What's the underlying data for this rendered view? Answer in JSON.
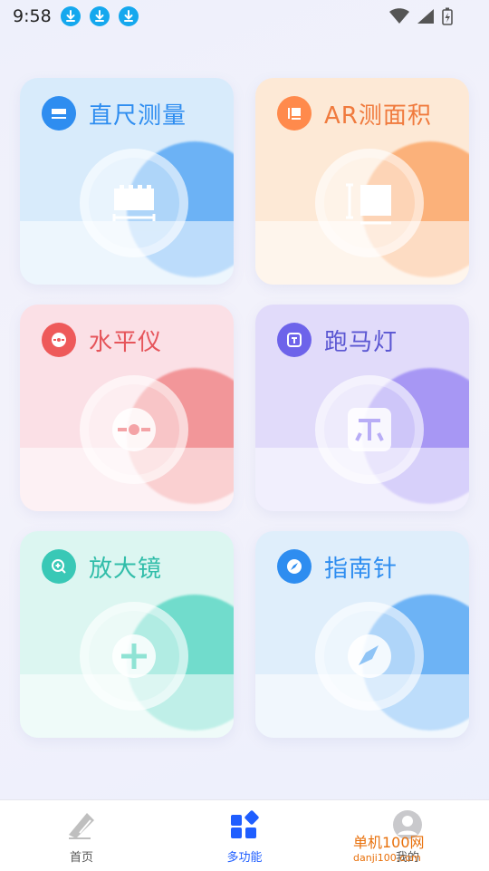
{
  "status": {
    "time": "9:58",
    "download_icons": [
      "download-icon",
      "download-icon",
      "download-icon"
    ]
  },
  "tools": [
    {
      "name": "直尺测量",
      "icon": "ruler-icon",
      "accent": "#2e8df0",
      "bg": "#d8ebfb",
      "glow": "#5aa9f5",
      "text": "#2e8df0"
    },
    {
      "name": "AR测面积",
      "icon": "area-icon",
      "accent": "#ff8a4c",
      "bg": "#fde9d6",
      "glow": "#fba86a",
      "text": "#f07a3d"
    },
    {
      "name": "水平仪",
      "icon": "level-icon",
      "accent": "#ee5a5a",
      "bg": "#fbe0e6",
      "glow": "#f18a8c",
      "text": "#e6555b"
    },
    {
      "name": "跑马灯",
      "icon": "marquee-icon",
      "accent": "#6d63ea",
      "bg": "#e1dbfa",
      "glow": "#9d8cf4",
      "text": "#5a56d2"
    },
    {
      "name": "放大镜",
      "icon": "magnifier-icon",
      "accent": "#39c8b6",
      "bg": "#dcf6f1",
      "glow": "#5fd8c6",
      "text": "#31bda9"
    },
    {
      "name": "指南针",
      "icon": "compass-icon",
      "accent": "#2e8df0",
      "bg": "#dfeefb",
      "glow": "#5aa9f5",
      "text": "#2e8df0"
    }
  ],
  "nav": {
    "items": [
      {
        "label": "首页",
        "icon": "ruler-tab-icon"
      },
      {
        "label": "多功能",
        "icon": "apps-icon"
      },
      {
        "label": "我的",
        "icon": "profile-icon"
      }
    ]
  },
  "watermark": {
    "text": "单机100网",
    "sub": "danji100.com"
  }
}
